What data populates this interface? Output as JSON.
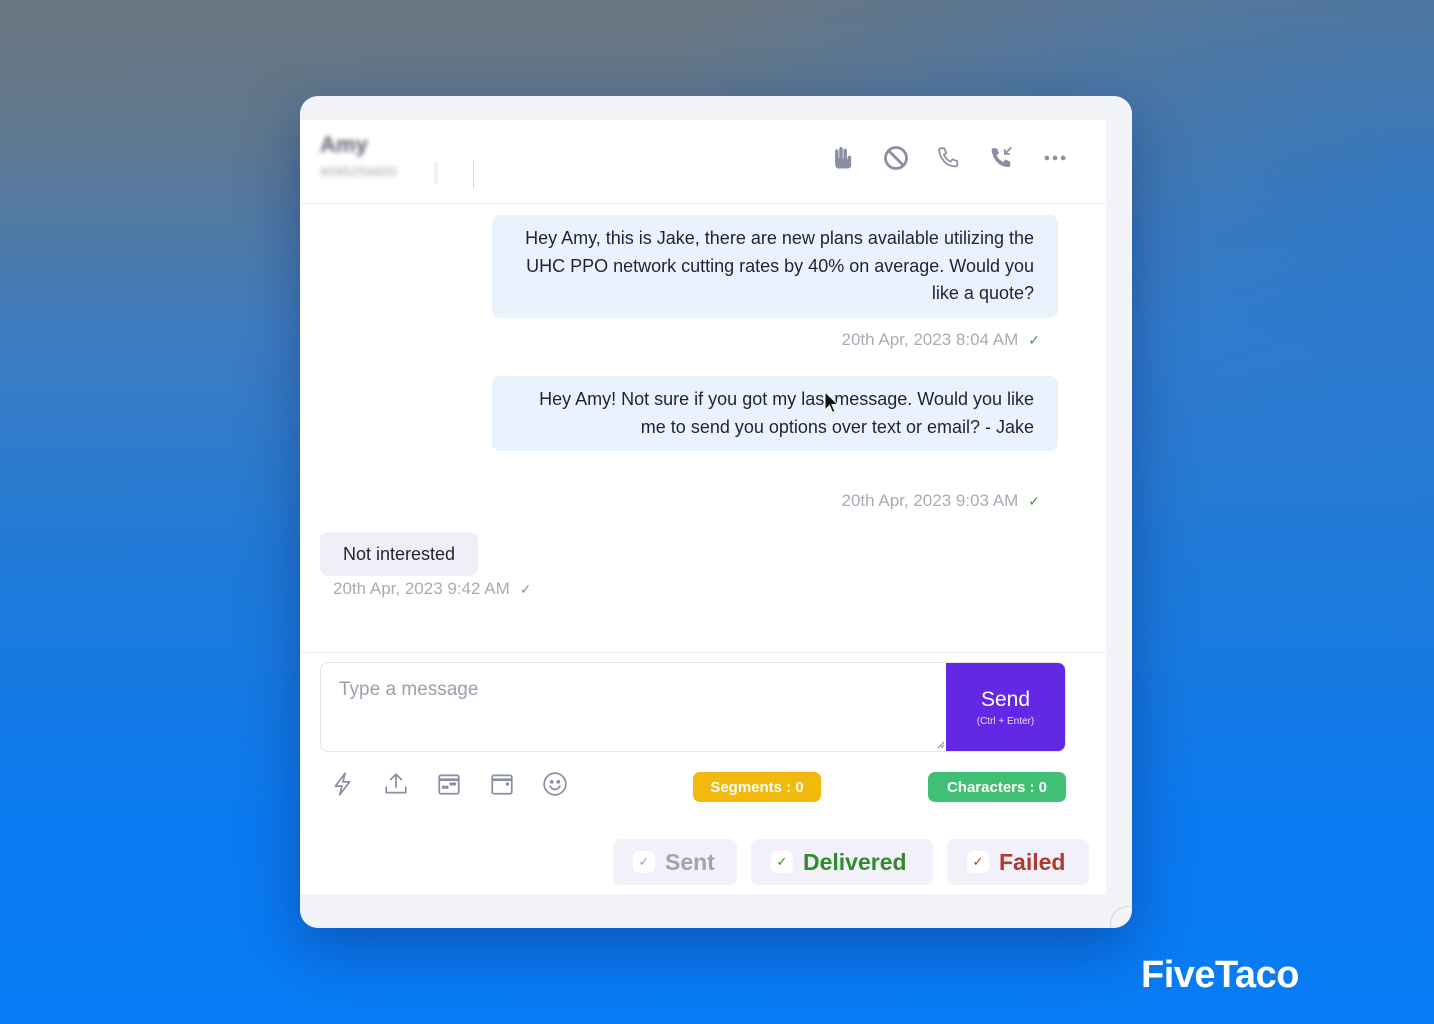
{
  "contact": {
    "name": "Amy",
    "phone": "9095256600"
  },
  "header_actions": [
    {
      "name": "raise-hand",
      "icon": "hand-icon"
    },
    {
      "name": "block",
      "icon": "block-icon"
    },
    {
      "name": "call",
      "icon": "phone-icon"
    },
    {
      "name": "incoming-call",
      "icon": "phone-incoming-icon"
    },
    {
      "name": "more",
      "icon": "more-horizontal-icon"
    }
  ],
  "messages": [
    {
      "direction": "outgoing",
      "text": "Hey Amy, this is Jake, there are new plans available utilizing the UHC PPO network cutting rates by 40% on average. Would you like a quote?",
      "timestamp": "20th Apr, 2023 8:04 AM",
      "status": "delivered"
    },
    {
      "direction": "outgoing",
      "text": "Hey Amy! Not sure if you got my last message. Would you like me to send you options over text or email? - Jake",
      "timestamp": "20th Apr, 2023 9:03 AM",
      "status": "delivered"
    },
    {
      "direction": "incoming",
      "text": "Not interested",
      "timestamp": "20th Apr, 2023 9:42 AM",
      "status": "read"
    }
  ],
  "composer": {
    "placeholder": "Type a message",
    "value": "",
    "send_label": "Send",
    "send_hint": "(Ctrl + Enter)"
  },
  "toolbar": [
    {
      "name": "quick-reply",
      "icon": "lightning-icon"
    },
    {
      "name": "upload",
      "icon": "upload-icon"
    },
    {
      "name": "schedule",
      "icon": "calendar-schedule-icon"
    },
    {
      "name": "calendar",
      "icon": "calendar-icon"
    },
    {
      "name": "emoji",
      "icon": "emoji-icon"
    }
  ],
  "counters": {
    "segments_label": "Segments : 0",
    "characters_label": "Characters : 0",
    "segments_color": "#f0b90b",
    "characters_color": "#40c074"
  },
  "status_filters": [
    {
      "label": "Sent",
      "checked": true,
      "color": "#a0a3b0"
    },
    {
      "label": "Delivered",
      "checked": true,
      "color": "#2e8b2e"
    },
    {
      "label": "Failed",
      "checked": true,
      "color": "#b03a2e"
    }
  ],
  "check_glyph": "✓",
  "brand": "FiveTaco",
  "accent_color": "#6328e6"
}
